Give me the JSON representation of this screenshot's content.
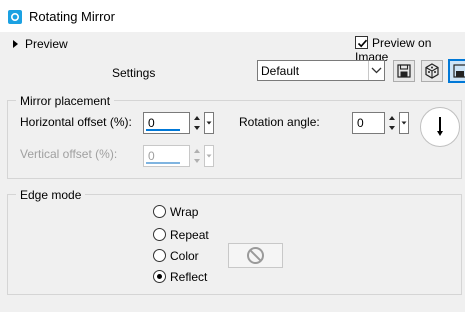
{
  "window": {
    "title": "Rotating Mirror",
    "icon": "app-icon",
    "accent": "#1ba1e2"
  },
  "preview_expander": {
    "label": "Preview",
    "icon": "triangle-right-icon"
  },
  "preview_on_image": {
    "label": "Preview on Image",
    "checked": true
  },
  "settings": {
    "label": "Settings",
    "preset": "Default",
    "tools": [
      "save-preset-icon",
      "randomize-icon",
      "load-preset-icon"
    ]
  },
  "mirror_placement": {
    "title": "Mirror placement",
    "horizontal_offset": {
      "label": "Horizontal offset (%):",
      "value": "0"
    },
    "vertical_offset": {
      "label": "Vertical offset (%):",
      "value": "0",
      "enabled": false
    },
    "rotation_angle": {
      "label": "Rotation angle:",
      "value": "0"
    }
  },
  "edge_mode": {
    "title": "Edge mode",
    "options": [
      {
        "label": "Wrap",
        "selected": false
      },
      {
        "label": "Repeat",
        "selected": false
      },
      {
        "label": "Color",
        "selected": false
      },
      {
        "label": "Reflect",
        "selected": true
      }
    ],
    "color_button_icon": "no-color-icon"
  }
}
